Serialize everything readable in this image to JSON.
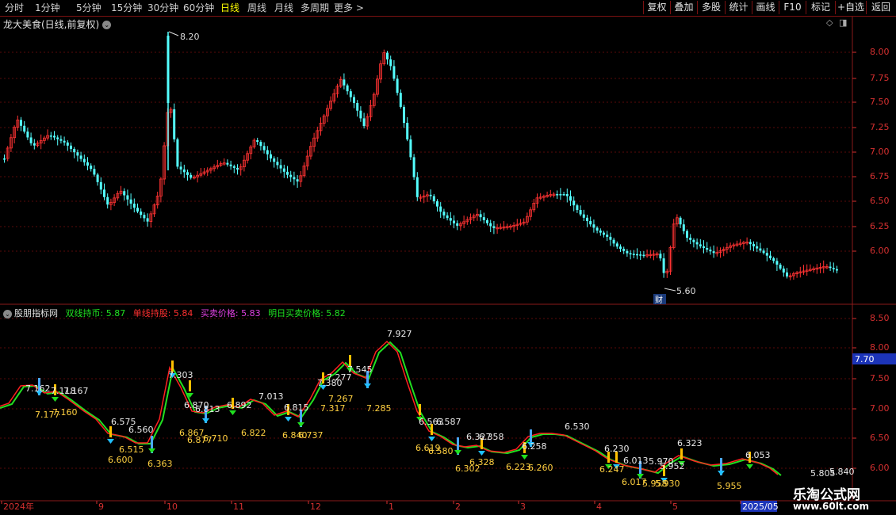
{
  "toolbar": {
    "periods": [
      "分时",
      "1分钟",
      "5分钟",
      "15分钟",
      "30分钟",
      "60分钟",
      "日线",
      "周线",
      "月线",
      "多周期",
      "更多 >"
    ],
    "active_period": "日线",
    "right_buttons": [
      "复权",
      "叠加",
      "多股",
      "统计",
      "画线",
      "F10",
      "标记",
      "+自选",
      "返回"
    ]
  },
  "stock": {
    "title": "龙大美食(日线,前复权)",
    "high_marker": "8.20",
    "low_marker": "5.60",
    "cai_badge": "财"
  },
  "price_axis": [
    "8.00",
    "7.75",
    "7.50",
    "7.25",
    "7.00",
    "6.75",
    "6.50",
    "6.25",
    "6.00"
  ],
  "indicator": {
    "name": "股朋指标网",
    "items": [
      {
        "label": "双线持币: 5.87",
        "color": "#20e020"
      },
      {
        "label": "单线持股: 5.84",
        "color": "#ff3030"
      },
      {
        "label": "买卖价格: 5.83",
        "color": "#e040e0"
      },
      {
        "label": "明日买卖价格: 5.82",
        "color": "#20e020"
      }
    ],
    "axis": [
      "8.50",
      "8.00",
      "7.50",
      "7.00",
      "6.50",
      "6.00"
    ],
    "current_value_tag": "7.70",
    "labels_up": [
      "7.162",
      "7.118",
      "7.167",
      "6.575",
      "6.560",
      "7.303",
      "6.870",
      "6.813",
      "6.892",
      "7.013",
      "6.815",
      "7.380",
      "7.277",
      "7.545",
      "7.927",
      "6.563",
      "6.587",
      "6.327",
      "6.358",
      "6.258",
      "6.530",
      "6.230",
      "6.013",
      "5.970",
      "5.952",
      "6.323",
      "6.053",
      "5.805",
      "5.840"
    ],
    "labels_down": [
      "7.177",
      "7.160",
      "6.515",
      "6.600",
      "6.363",
      "6.867",
      "6.877",
      "6.710",
      "6.822",
      "6.840",
      "6.737",
      "7.317",
      "7.267",
      "7.285",
      "6.619",
      "6.580",
      "6.302",
      "6.328",
      "6.223",
      "6.260",
      "6.247",
      "6.017",
      "5.958",
      "5.930",
      "5.955"
    ]
  },
  "time_axis": [
    "2024年",
    "9",
    "10",
    "11",
    "12",
    "1",
    "2",
    "3",
    "4",
    "5",
    "2025/05"
  ],
  "watermark": {
    "top": "乐淘公式网",
    "bottom": "www.60lt.com"
  }
}
